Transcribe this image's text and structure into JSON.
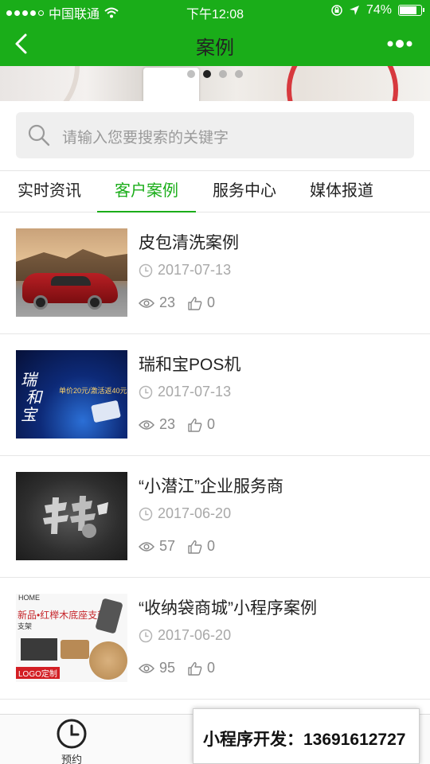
{
  "status_bar": {
    "carrier": "中国联通",
    "time": "下午12:08",
    "battery": "74%",
    "battery_level": 0.74
  },
  "nav": {
    "title": "案例"
  },
  "banner": {
    "active_page": 2,
    "page_count": 4
  },
  "search": {
    "placeholder": "请输入您要搜索的关键字"
  },
  "tabs": [
    {
      "label": "实时资讯",
      "active": false
    },
    {
      "label": "客户案例",
      "active": true
    },
    {
      "label": "服务中心",
      "active": false
    },
    {
      "label": "媒体报道",
      "active": false
    }
  ],
  "articles": [
    {
      "title": "皮包清洗案例",
      "date": "2017-07-13",
      "views": "23",
      "likes": "0"
    },
    {
      "title": "瑞和宝POS机",
      "date": "2017-07-13",
      "views": "23",
      "likes": "0"
    },
    {
      "title": "“小潜江”企业服务商",
      "date": "2017-06-20",
      "views": "57",
      "likes": "0"
    },
    {
      "title": "“收纳袋商城”小程序案例",
      "date": "2017-06-20",
      "views": "95",
      "likes": "0"
    }
  ],
  "tabbar": {
    "items": [
      {
        "label": "预约",
        "icon": "clock-icon"
      }
    ]
  },
  "contact": {
    "text": "小程序开发：13691612727"
  },
  "colors": {
    "brand": "#1aad19",
    "text": "#222222",
    "muted": "#a8a8a8"
  }
}
